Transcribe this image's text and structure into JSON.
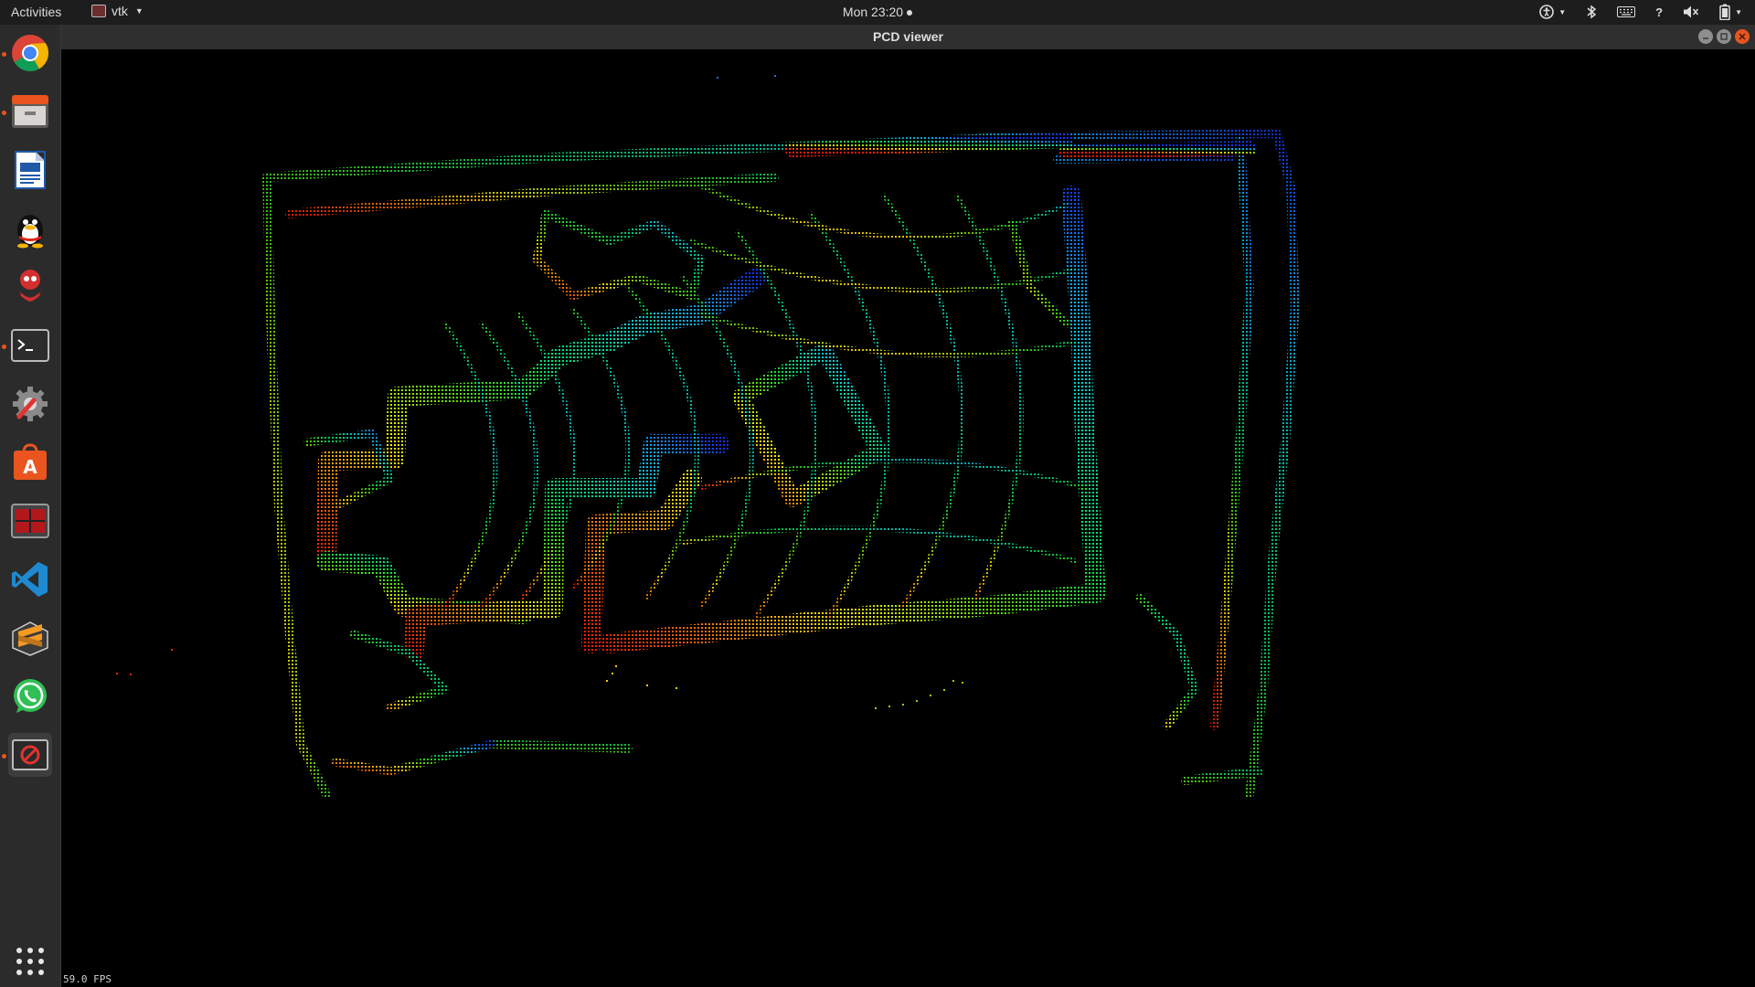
{
  "topbar": {
    "activities": "Activities",
    "app_name": "vtk",
    "clock": "Mon 23:20"
  },
  "tray": [
    "accessibility-icon",
    "bluetooth-icon",
    "keyboard-icon",
    "help-icon",
    "volume-icon",
    "battery-icon"
  ],
  "dock": [
    {
      "name": "chrome",
      "running": true
    },
    {
      "name": "files",
      "running": true
    },
    {
      "name": "writer",
      "running": false
    },
    {
      "name": "qq",
      "running": false
    },
    {
      "name": "red-app",
      "running": false
    },
    {
      "name": "terminal",
      "running": true
    },
    {
      "name": "settings",
      "running": false
    },
    {
      "name": "software-center",
      "running": false
    },
    {
      "name": "red-console",
      "running": false
    },
    {
      "name": "vscode",
      "running": false
    },
    {
      "name": "sublime",
      "running": false
    },
    {
      "name": "whatsapp",
      "running": false
    },
    {
      "name": "pcd-viewer",
      "running": true,
      "active": true
    },
    {
      "name": "show-applications",
      "running": false
    }
  ],
  "window": {
    "title": "PCD viewer",
    "fps_text": "59.0 FPS"
  },
  "colors": {
    "topbar_bg": "#1d1d1d",
    "dock_bg": "#2b2b2b",
    "close_button": "#e9541f",
    "viewport_bg": "#000000"
  }
}
